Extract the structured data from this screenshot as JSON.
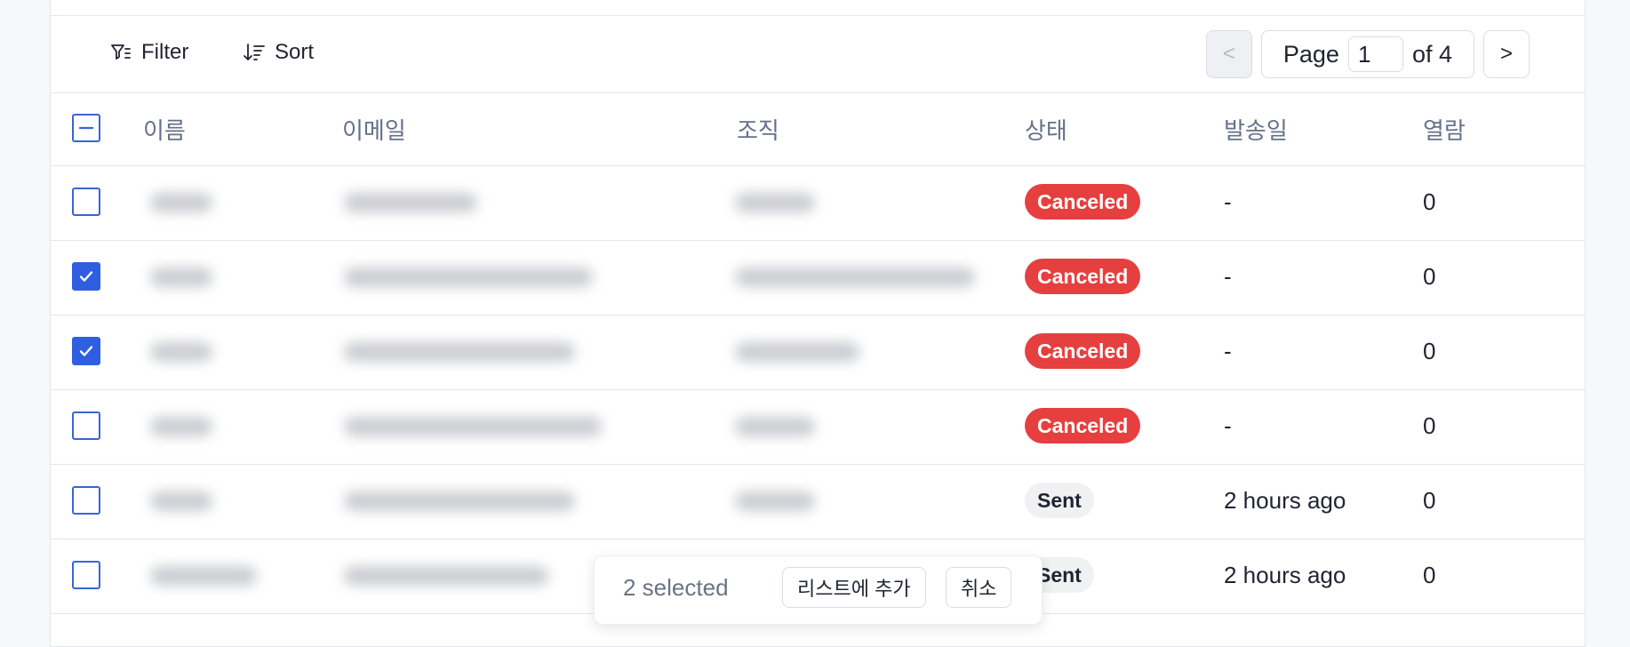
{
  "toolbar": {
    "filter_label": "Filter",
    "sort_label": "Sort"
  },
  "pagination": {
    "prev": "<",
    "next": ">",
    "page_label": "Page",
    "current": "1",
    "of_label": "of 4"
  },
  "table": {
    "headers": {
      "name": "이름",
      "email": "이메일",
      "org": "조직",
      "status": "상태",
      "sent_at": "발송일",
      "opens": "열람"
    },
    "rows": [
      {
        "status": "Canceled",
        "sent_at": "-",
        "opens": "0"
      },
      {
        "status": "Canceled",
        "sent_at": "-",
        "opens": "0"
      },
      {
        "status": "Canceled",
        "sent_at": "-",
        "opens": "0"
      },
      {
        "status": "Canceled",
        "sent_at": "-",
        "opens": "0"
      },
      {
        "status": "Sent",
        "sent_at": "2 hours ago",
        "opens": "0"
      },
      {
        "status": "Sent",
        "sent_at": "2 hours ago",
        "opens": "0"
      }
    ]
  },
  "selection_bar": {
    "count_text": "2 selected",
    "add_to_list_label": "리스트에 추가",
    "cancel_label": "취소"
  },
  "colors": {
    "accent": "#2f5fe0",
    "canceled": "#e5403f",
    "sent_bg": "#f0f1f3"
  }
}
